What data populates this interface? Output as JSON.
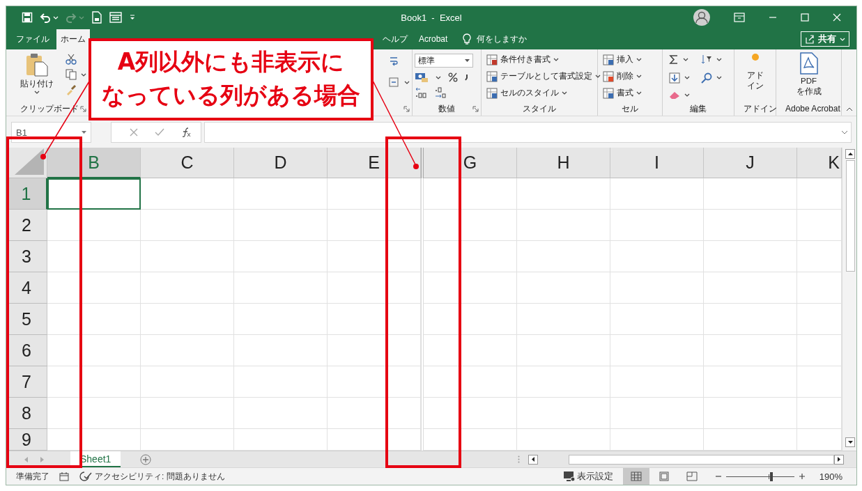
{
  "title_bar": {
    "title": "Book1  -  Excel"
  },
  "ribbon_tabs": [
    {
      "label": "ファイル",
      "selected": false
    },
    {
      "label": "ホーム",
      "selected": true
    },
    {
      "label": "ヘルプ",
      "selected": false
    },
    {
      "label": "Acrobat",
      "selected": false
    }
  ],
  "tell_me": {
    "placeholder": "何をしますか"
  },
  "share_button": {
    "label": "共有"
  },
  "ribbon_groups": [
    {
      "kind": "clipboard",
      "label": "クリップボード",
      "paste": "貼り付け",
      "launcher": true
    },
    {
      "kind": "alignment",
      "launcher": true
    },
    {
      "kind": "number",
      "label": "数値",
      "format": "標準",
      "launcher": true
    },
    {
      "kind": "commands",
      "label": "スタイル",
      "commands": [
        "条件付き書式",
        "テーブルとして書式設定",
        "セルのスタイル"
      ],
      "launcher": false
    },
    {
      "kind": "cells",
      "label": "セル",
      "commands": [
        "挿入",
        "削除",
        "書式"
      ],
      "launcher": false
    },
    {
      "kind": "editing",
      "label": "編集",
      "launcher": false
    },
    {
      "kind": "addins",
      "label": "アドイン",
      "button_lines": [
        "アド",
        "イン"
      ],
      "launcher": false
    },
    {
      "kind": "acrobat",
      "label": "Adobe Acrobat",
      "button_lines": [
        "PDF",
        "を作成"
      ],
      "launcher": false
    }
  ],
  "formula_bar": {
    "name_box": "B1"
  },
  "grid": {
    "columns": [
      {
        "kind": "column",
        "label": "B",
        "selected": true
      },
      {
        "kind": "column",
        "label": "C",
        "selected": false
      },
      {
        "kind": "column",
        "label": "D",
        "selected": false
      },
      {
        "kind": "column",
        "label": "E",
        "selected": false
      },
      {
        "kind": "hidden"
      },
      {
        "kind": "column",
        "label": "G",
        "selected": false
      },
      {
        "kind": "column",
        "label": "H",
        "selected": false
      },
      {
        "kind": "column",
        "label": "I",
        "selected": false
      },
      {
        "kind": "column",
        "label": "J",
        "selected": false
      },
      {
        "kind": "column",
        "label": "K",
        "selected": false
      }
    ],
    "rows": [
      {
        "label": "1",
        "selected": true
      },
      {
        "label": "2",
        "selected": false
      },
      {
        "label": "3",
        "selected": false
      },
      {
        "label": "4",
        "selected": false
      },
      {
        "label": "5",
        "selected": false
      },
      {
        "label": "6",
        "selected": false
      },
      {
        "label": "7",
        "selected": false
      },
      {
        "label": "8",
        "selected": false
      },
      {
        "label": "9",
        "selected": false
      }
    ]
  },
  "sheet_tabs": [
    {
      "label": "Sheet1",
      "selected": true
    }
  ],
  "status_bar": {
    "mode": "準備完了",
    "accessibility": "アクセシビリティ: 問題ありません",
    "display_settings": "表示設定",
    "views": [
      {
        "kind": "normal",
        "selected": true
      },
      {
        "kind": "page-layout",
        "selected": false
      },
      {
        "kind": "page-break",
        "selected": false
      }
    ],
    "zoom": {
      "level": 0.67,
      "reading": "190%"
    }
  },
  "callout": {
    "lines": [
      "A列以外にも非表示に",
      "なっている列がある場合"
    ]
  }
}
